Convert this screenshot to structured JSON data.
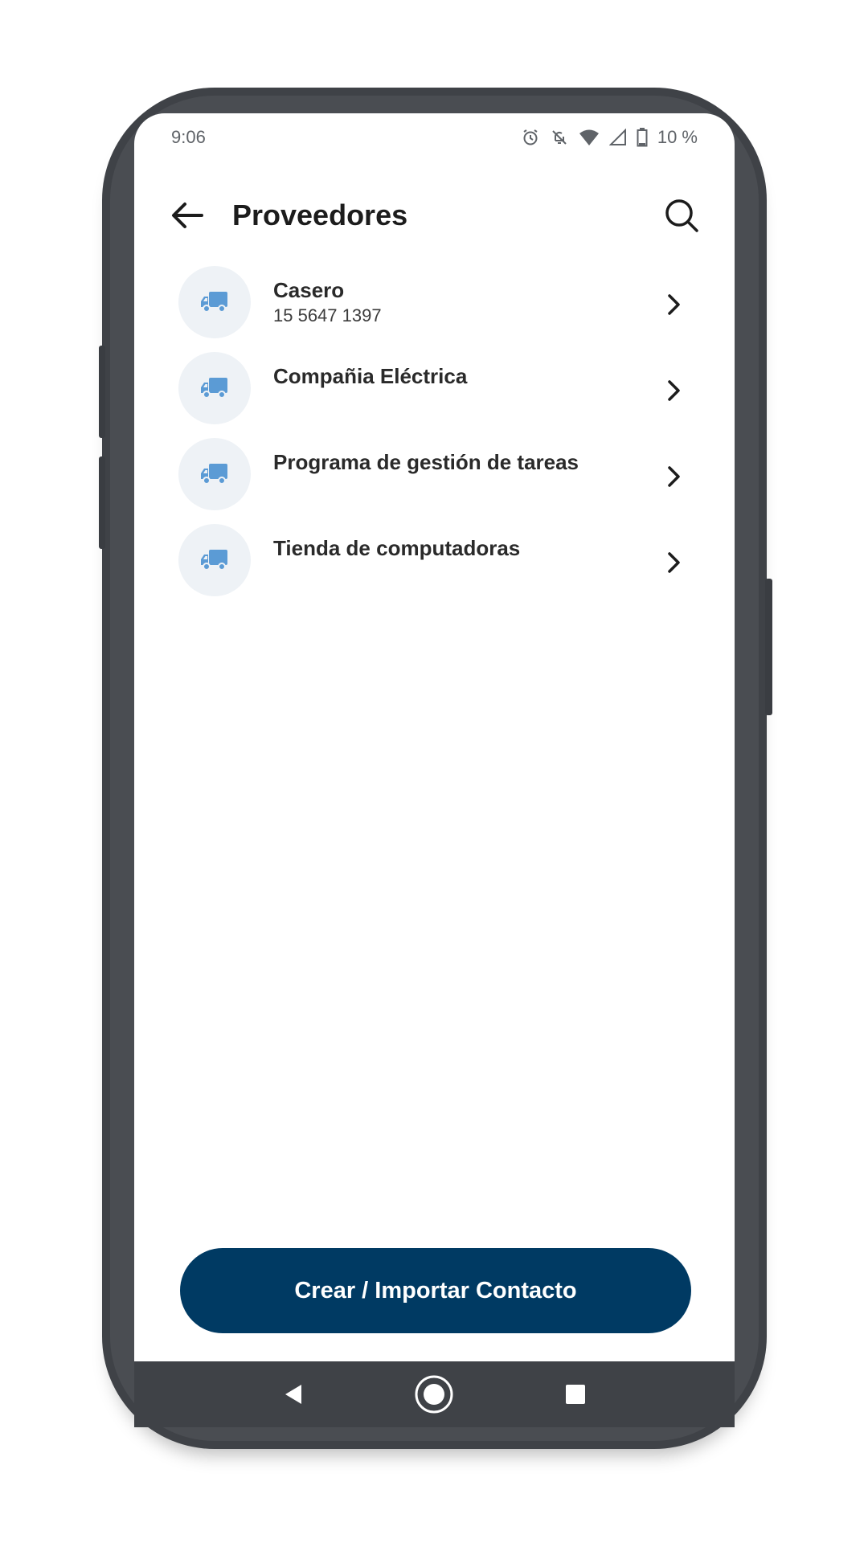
{
  "status_bar": {
    "time": "9:06",
    "battery": "10 %",
    "icons": [
      "alarm-icon",
      "notifications-off-icon",
      "wifi-icon",
      "signal-icon",
      "battery-icon"
    ]
  },
  "header": {
    "title": "Proveedores",
    "back_icon": "arrow-left-icon",
    "search_icon": "search-icon"
  },
  "contacts": [
    {
      "name": "Casero",
      "phone": "15 5647 1397",
      "icon": "truck-icon"
    },
    {
      "name": "Compañia Eléctrica",
      "phone": "",
      "icon": "truck-icon"
    },
    {
      "name": "Programa de gestión de tareas",
      "phone": "",
      "icon": "truck-icon"
    },
    {
      "name": "Tienda de computadoras",
      "phone": "",
      "icon": "truck-icon"
    }
  ],
  "cta": {
    "label": "Crear / Importar Contacto"
  },
  "nav": {
    "icons": [
      "back-triangle-icon",
      "home-circle-icon",
      "recents-square-icon"
    ]
  },
  "colors": {
    "accent": "#003a63",
    "icon_blue": "#5b9bd5",
    "avatar_bg": "#eef2f6",
    "frame": "#3f4247"
  }
}
